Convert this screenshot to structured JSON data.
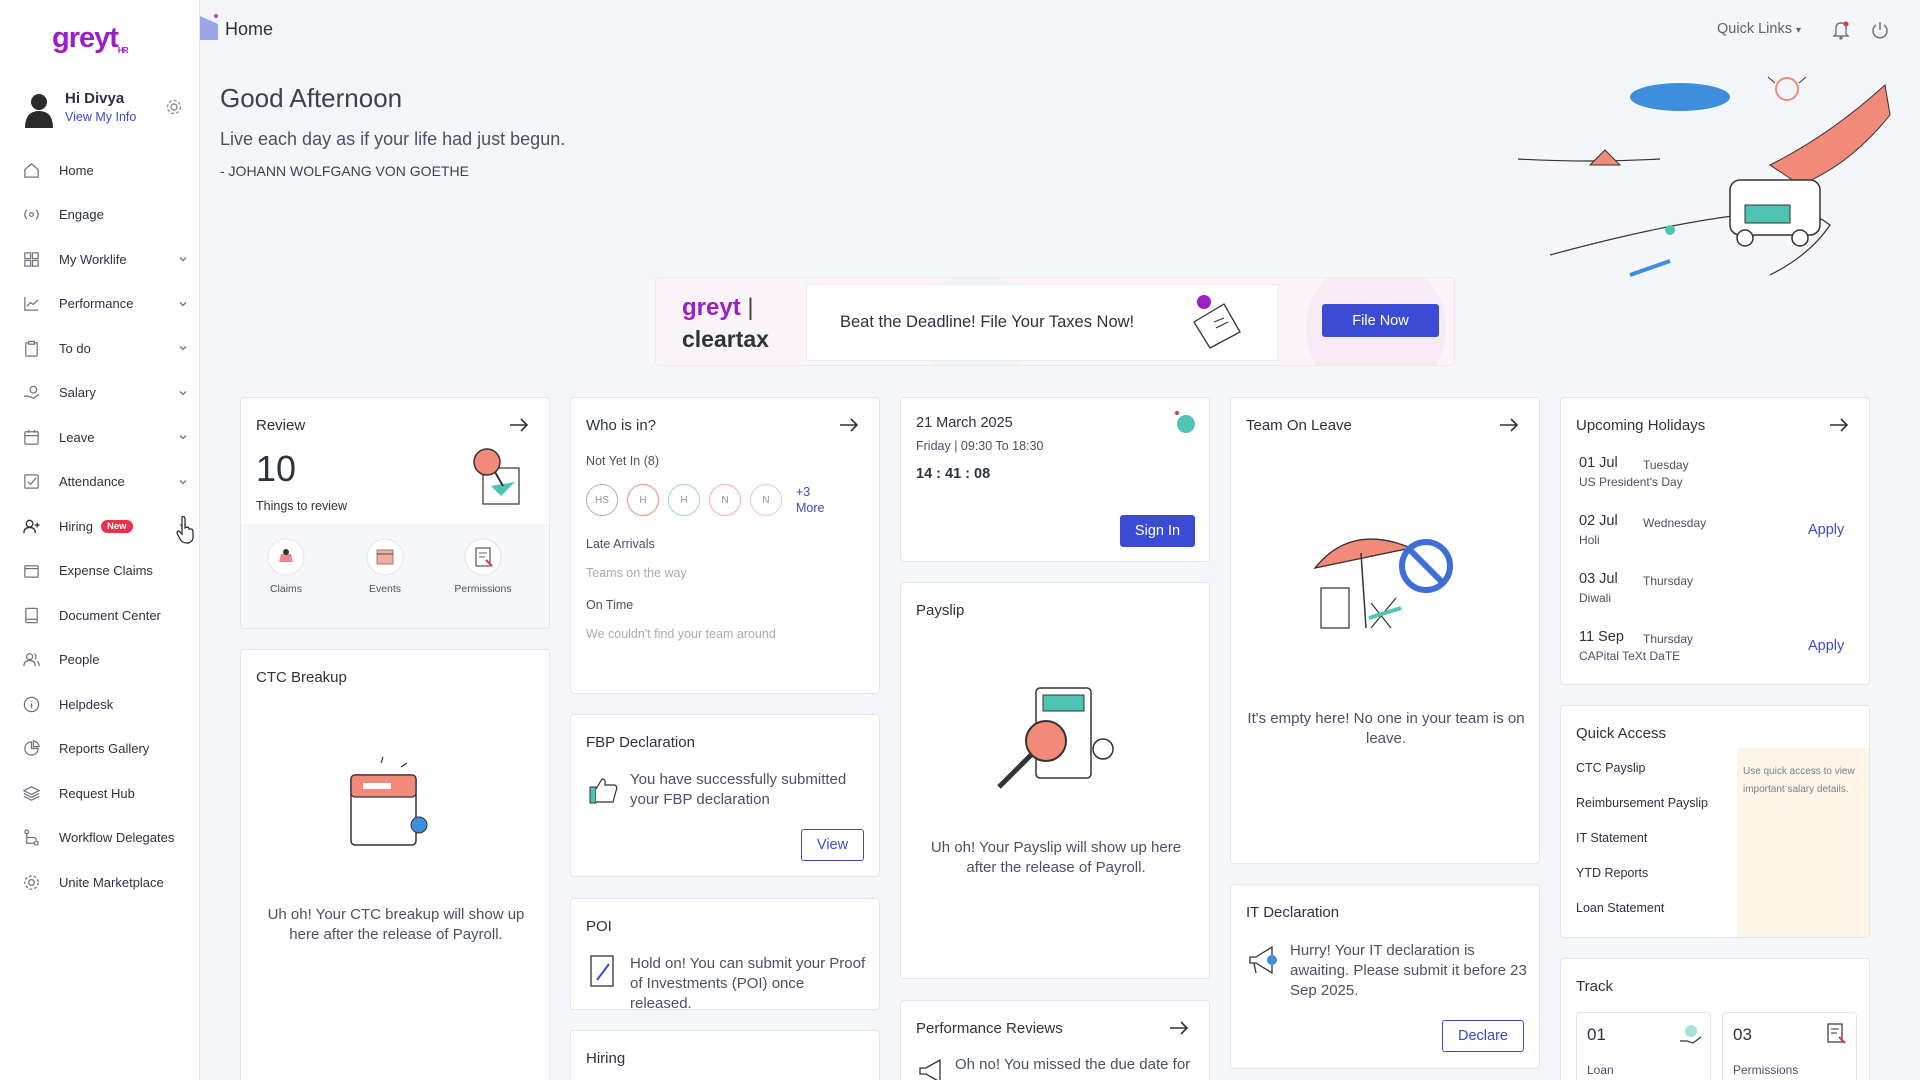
{
  "app": {
    "logo": "greyt",
    "logo_sub": "HR"
  },
  "user": {
    "greeting": "Hi Divya",
    "link": "View My Info"
  },
  "nav": [
    {
      "label": "Home"
    },
    {
      "label": "Engage"
    },
    {
      "label": "My Worklife"
    },
    {
      "label": "Performance"
    },
    {
      "label": "To do"
    },
    {
      "label": "Salary"
    },
    {
      "label": "Leave"
    },
    {
      "label": "Attendance"
    },
    {
      "label": "Hiring",
      "badge": "New"
    },
    {
      "label": "Expense Claims"
    },
    {
      "label": "Document Center"
    },
    {
      "label": "People"
    },
    {
      "label": "Helpdesk"
    },
    {
      "label": "Reports Gallery"
    },
    {
      "label": "Request Hub"
    },
    {
      "label": "Workflow Delegates"
    },
    {
      "label": "Unite Marketplace"
    }
  ],
  "topbar": {
    "title": "Home",
    "quick_links": "Quick Links"
  },
  "hero": {
    "greeting": "Good Afternoon",
    "quote": "Live each day as if your life had just begun.",
    "author": "- JOHANN WOLFGANG VON GOETHE"
  },
  "banner": {
    "brand1": "greyt",
    "brand2": "cleartax",
    "text": "Beat the Deadline! File Your Taxes Now!",
    "button": "File Now"
  },
  "review": {
    "title": "Review",
    "count": "10",
    "caption": "Things to review",
    "actions": [
      "Claims",
      "Events",
      "Permissions"
    ]
  },
  "whoisin": {
    "title": "Who is in?",
    "not_yet": "Not Yet In",
    "not_yet_count": "(8)",
    "initials": [
      "HS",
      "H",
      "H",
      "N",
      "N"
    ],
    "more_count": "+3",
    "more": "More",
    "late_label": "Late Arrivals",
    "late_text": "Teams on the way",
    "ontime_label": "On Time",
    "ontime_text": "We couldn't find your team around"
  },
  "attendance": {
    "date": "21 March 2025",
    "shift": "Friday | 09:30 To 18:30",
    "time": "14 : 41 : 08",
    "button": "Sign In"
  },
  "team_leave": {
    "title": "Team On Leave",
    "empty": "It's empty here! No one in your team is on leave."
  },
  "holidays": {
    "title": "Upcoming Holidays",
    "items": [
      {
        "date": "01 Jul",
        "day": "Tuesday",
        "name": "US President's Day",
        "apply": ""
      },
      {
        "date": "02 Jul",
        "day": "Wednesday",
        "name": "Holi",
        "apply": "Apply"
      },
      {
        "date": "03 Jul",
        "day": "Thursday",
        "name": "Diwali",
        "apply": ""
      },
      {
        "date": "11 Sep",
        "day": "Thursday",
        "name": "CAPital TeXt DaTE",
        "apply": "Apply"
      }
    ]
  },
  "ctc": {
    "title": "CTC Breakup",
    "empty": "Uh oh! Your CTC breakup will show up here after the release of Payroll."
  },
  "fbp": {
    "title": "FBP Declaration",
    "text": "You have successfully submitted your FBP declaration",
    "button": "View"
  },
  "payslip": {
    "title": "Payslip",
    "empty": "Uh oh! Your Payslip will show up here after the release of Payroll."
  },
  "poi": {
    "title": "POI",
    "text": "Hold on! You can submit your Proof of Investments (POI) once released."
  },
  "hiring": {
    "title": "Hiring"
  },
  "perf_reviews": {
    "title": "Performance Reviews",
    "text": "Oh no! You missed the due date for"
  },
  "it_decl": {
    "title": "IT Declaration",
    "text": "Hurry! Your IT declaration is awaiting. Please submit it before 23 Sep 2025.",
    "button": "Declare"
  },
  "quick_access": {
    "title": "Quick Access",
    "items": [
      "CTC Payslip",
      "Reimbursement Payslip",
      "IT Statement",
      "YTD Reports",
      "Loan Statement"
    ],
    "note": "Use quick access to view important salary details."
  },
  "track": {
    "title": "Track",
    "items": [
      {
        "count": "01",
        "label": "Loan"
      },
      {
        "count": "03",
        "label": "Permissions"
      }
    ]
  },
  "colors": {
    "accent": "#3c4bd6",
    "brand": "#9b1fc4",
    "badge": "#e5334b",
    "salmon": "#f28a7a"
  }
}
